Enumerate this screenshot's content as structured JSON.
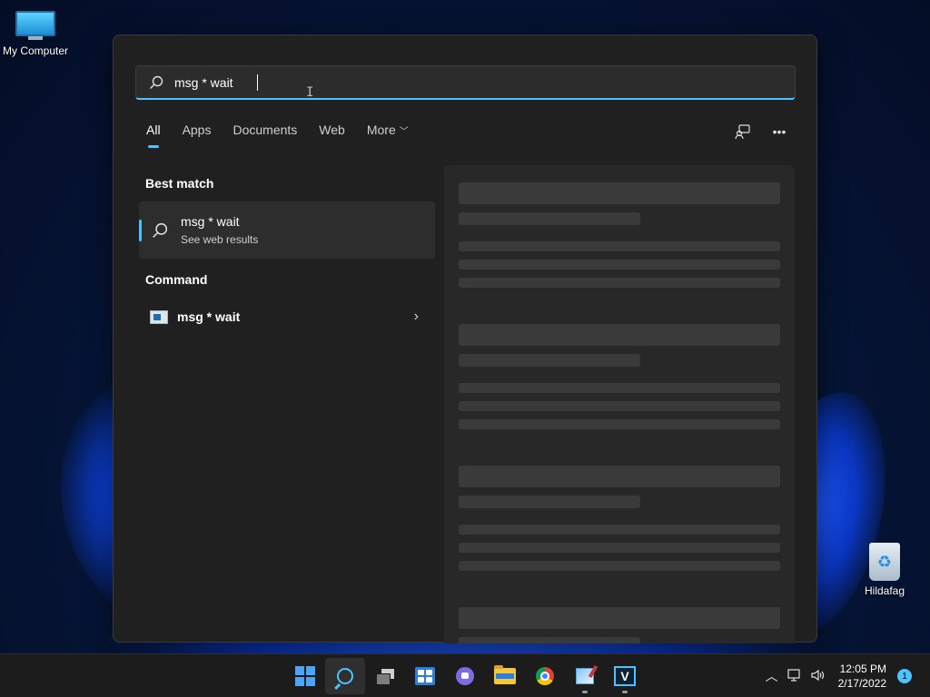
{
  "desktop": {
    "icons": [
      {
        "label": "My Computer",
        "icon": "monitor-icon"
      },
      {
        "label": "Hildafag",
        "icon": "recycle-bin-icon"
      }
    ]
  },
  "search": {
    "query": "msg * wait",
    "tabs": [
      {
        "label": "All",
        "active": true
      },
      {
        "label": "Apps"
      },
      {
        "label": "Documents"
      },
      {
        "label": "Web"
      },
      {
        "label": "More"
      }
    ],
    "best_match": {
      "section_title": "Best match",
      "title": "msg * wait",
      "subtitle": "See web results",
      "icon": "search-icon"
    },
    "command": {
      "section_title": "Command",
      "title": "msg * wait",
      "icon": "command-window-icon"
    }
  },
  "taskbar": {
    "apps": [
      "start-icon",
      "search-icon",
      "task-view-icon",
      "widgets-icon",
      "chat-icon",
      "file-explorer-icon",
      "chrome-icon",
      "paint-icon",
      "v-app-icon"
    ],
    "clock": {
      "time": "12:05 PM",
      "date": "2/17/2022"
    },
    "notification_count": "1"
  },
  "colors": {
    "accent": "#4cc2ff",
    "panel": "#202020"
  }
}
